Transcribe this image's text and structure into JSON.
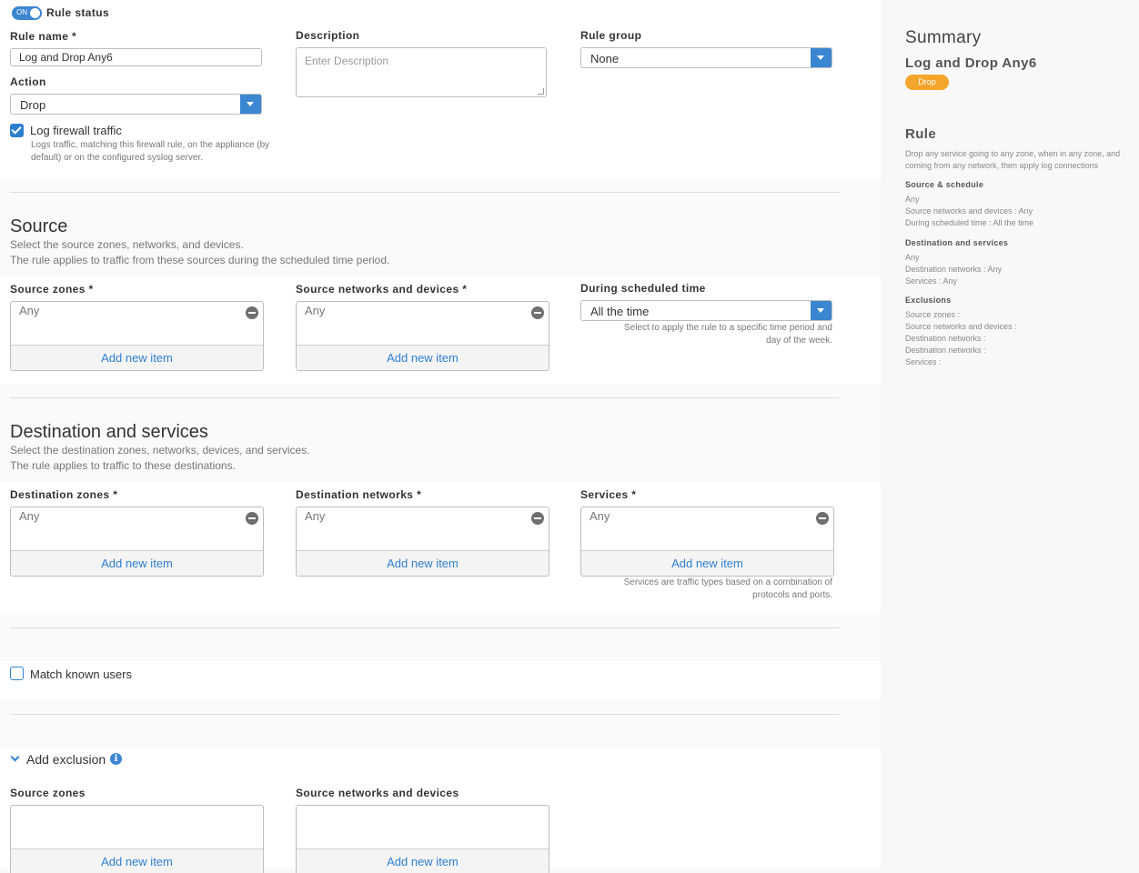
{
  "rule_status": {
    "toggle_text": "ON",
    "label": "Rule status"
  },
  "rule_name": {
    "label": "Rule name *",
    "value": "Log and Drop Any6"
  },
  "description": {
    "label": "Description",
    "placeholder": "Enter Description"
  },
  "rule_group": {
    "label": "Rule group",
    "value": "None"
  },
  "action": {
    "label": "Action",
    "value": "Drop"
  },
  "log_traffic": {
    "label": "Log firewall traffic",
    "checked": true,
    "help_line1": "Logs traffic, matching this firewall rule, on the appliance (by",
    "help_line2": "default) or on the configured syslog server."
  },
  "source": {
    "title": "Source",
    "desc_line1": "Select the source zones, networks, and devices.",
    "desc_line2": "The rule applies to traffic from these sources during the scheduled time period.",
    "zones": {
      "label": "Source zones *",
      "item": "Any",
      "add": "Add new item"
    },
    "networks": {
      "label": "Source networks and devices *",
      "item": "Any",
      "add": "Add new item"
    },
    "schedule": {
      "label": "During scheduled time",
      "value": "All the time",
      "help_line1": "Select to apply the rule to a specific time period and",
      "help_line2": "day of the week."
    }
  },
  "destination": {
    "title": "Destination and services",
    "desc_line1": "Select the destination zones, networks, devices, and services.",
    "desc_line2": "The rule applies to traffic to these destinations.",
    "zones": {
      "label": "Destination zones *",
      "item": "Any",
      "add": "Add new item"
    },
    "networks": {
      "label": "Destination networks *",
      "item": "Any",
      "add": "Add new item"
    },
    "services": {
      "label": "Services *",
      "item": "Any",
      "add": "Add new item",
      "help_line1": "Services are traffic types based on a combination of",
      "help_line2": "protocols and ports."
    }
  },
  "match_users": {
    "label": "Match known users",
    "checked": false
  },
  "exclusion": {
    "title": "Add exclusion",
    "zones": {
      "label": "Source zones",
      "add": "Add new item"
    },
    "networks": {
      "label": "Source networks and devices",
      "add": "Add new item"
    }
  },
  "summary": {
    "title": "Summary",
    "rule_name": "Log and Drop Any6",
    "action_badge": "Drop",
    "rule_heading": "Rule",
    "rule_desc_line1": "Drop any service going to any zone, when in any zone, and",
    "rule_desc_line2": "coming from any network, then apply log connections",
    "source_schedule": {
      "title": "Source & schedule",
      "lines": [
        "Any",
        "Source networks and devices : Any",
        "During scheduled time : All the time"
      ]
    },
    "destination_services": {
      "title": "Destination and services",
      "lines": [
        "Any",
        "Destination networks : Any",
        "Services : Any"
      ]
    },
    "exclusions": {
      "title": "Exclusions",
      "lines": [
        "Source zones :",
        "Source networks and devices :",
        "Destination networks :",
        "Destination networks :",
        "Services :"
      ]
    }
  },
  "colors": {
    "accent": "#3b86d1",
    "badge": "#f3a62b",
    "link": "#2f7fd0"
  }
}
